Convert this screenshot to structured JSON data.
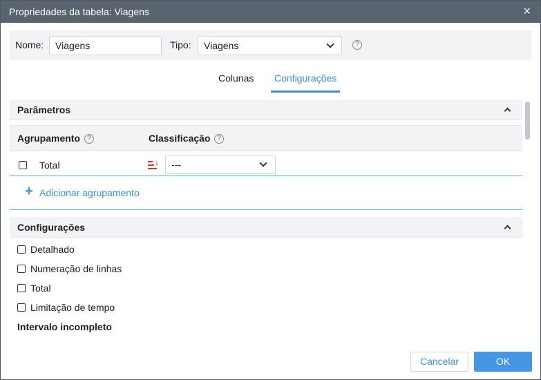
{
  "window": {
    "title": "Propriedades da tabela: Viagens",
    "close_icon": "×"
  },
  "form": {
    "name_label": "Nome:",
    "name_value": "Viagens",
    "type_label": "Tipo:",
    "type_value": "Viagens",
    "help_glyph": "?"
  },
  "tabs": [
    {
      "label": "Colunas",
      "active": false
    },
    {
      "label": "Configurações",
      "active": true
    }
  ],
  "parameters": {
    "title": "Parâmetros",
    "grouping_label": "Agrupamento",
    "sorting_label": "Classificação",
    "row": {
      "label": "Total",
      "checked": false,
      "sort_value": "---"
    },
    "add_grouping_label": "Adicionar agrupamento",
    "add_icon": "+"
  },
  "settings": {
    "title": "Configurações",
    "options": [
      {
        "label": "Detalhado",
        "checked": false
      },
      {
        "label": "Numeração de linhas",
        "checked": false
      },
      {
        "label": "Total",
        "checked": false
      },
      {
        "label": "Limitação de tempo",
        "checked": false
      }
    ],
    "incomplete_interval_label": "Intervalo incompleto"
  },
  "footer": {
    "cancel_label": "Cancelar",
    "ok_label": "OK"
  },
  "colors": {
    "accent": "#3f8bd8",
    "titlebar": "#5a6470",
    "ok_button": "#4597e6",
    "sort_icon": "#e0322c",
    "add_box_border": "#4fc3dd"
  }
}
